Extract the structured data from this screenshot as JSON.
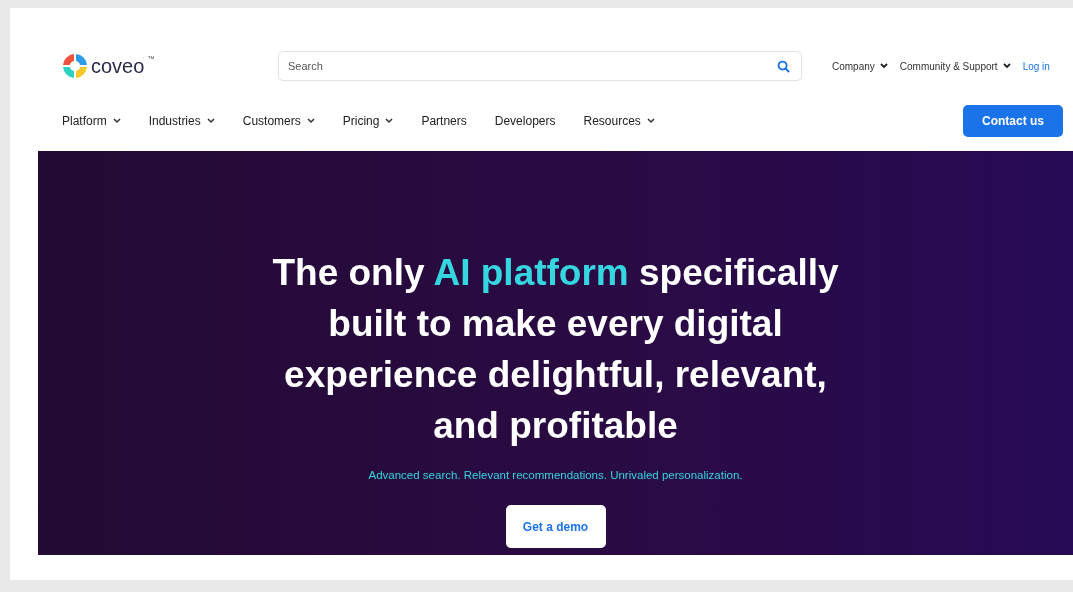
{
  "header": {
    "logo": "coveo",
    "logo_mark": "™",
    "search": {
      "placeholder": "Search"
    },
    "utility_links": [
      {
        "label": "Company",
        "kind": "dropdown"
      },
      {
        "label": "Community & Support",
        "kind": "dropdown"
      },
      {
        "label": "Log in",
        "kind": "link"
      }
    ],
    "nav": [
      {
        "label": "Platform",
        "dropdown": true
      },
      {
        "label": "Industries",
        "dropdown": true
      },
      {
        "label": "Customers",
        "dropdown": true
      },
      {
        "label": "Pricing",
        "dropdown": true
      },
      {
        "label": "Partners",
        "dropdown": false
      },
      {
        "label": "Developers",
        "dropdown": false
      },
      {
        "label": "Resources",
        "dropdown": true
      }
    ],
    "cta": "Contact us"
  },
  "hero": {
    "headline_lines": [
      [
        {
          "text": "The only ",
          "highlight": false
        },
        {
          "text": "AI platform",
          "highlight": true
        },
        {
          "text": " specifically",
          "highlight": false
        }
      ],
      [
        {
          "text": "built to make every digital",
          "highlight": false
        }
      ],
      [
        {
          "text": "experience delightful, relevant,",
          "highlight": false
        }
      ],
      [
        {
          "text": "and profitable",
          "highlight": false
        }
      ]
    ],
    "subtitle": "Advanced search. Relevant recommendations. Unrivaled personalization.",
    "button": "Get a demo"
  }
}
